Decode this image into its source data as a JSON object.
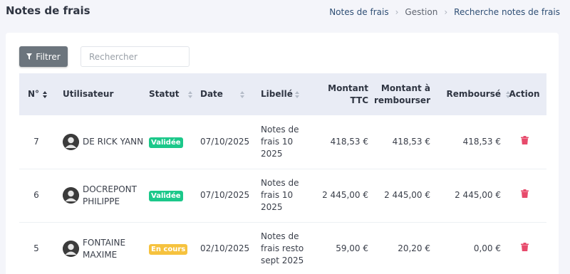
{
  "header": {
    "title": "Notes de frais",
    "breadcrumb": [
      {
        "label": "Notes de frais",
        "link": true
      },
      {
        "label": "Gestion",
        "link": false
      },
      {
        "label": "Recherche notes de frais",
        "link": true
      }
    ]
  },
  "toolbar": {
    "filter_label": "Filtrer",
    "search_placeholder": "Rechercher"
  },
  "table": {
    "columns": {
      "no": "N°",
      "user": "Utilisateur",
      "statut": "Statut",
      "date": "Date",
      "libelle": "Libellé",
      "ttc_line1": "Montant",
      "ttc_line2": "TTC",
      "remb_line1": "Montant à",
      "remb_line2": "rembourser",
      "rembourse": "Remboursé",
      "action": "Action"
    },
    "rows": [
      {
        "no": "7",
        "user_line1": "DE RICK YANN",
        "user_line2": "",
        "statut": "Validée",
        "date": "07/10/2025",
        "lib1": "Notes de",
        "lib2": "frais 10",
        "lib3": "2025",
        "ttc": "418,53 €",
        "remb": "418,53 €",
        "rembourse": "418,53 €"
      },
      {
        "no": "6",
        "user_line1": "DOCREPONT",
        "user_line2": "PHILIPPE",
        "statut": "Validée",
        "date": "07/10/2025",
        "lib1": "Notes de",
        "lib2": "frais 10",
        "lib3": "2025",
        "ttc": "2 445,00 €",
        "remb": "2 445,00 €",
        "rembourse": "2 445,00 €"
      },
      {
        "no": "5",
        "user_line1": "FONTAINE",
        "user_line2": "MAXIME",
        "statut": "En cours",
        "date": "02/10/2025",
        "lib1": "Notes de",
        "lib2": "frais resto",
        "lib3": "sept 2025",
        "ttc": "59,00 €",
        "remb": "20,20 €",
        "rembourse": "0,00 €"
      }
    ]
  },
  "icons": {
    "filter": "funnel-icon",
    "sort": "sort-icon",
    "avatar": "user-avatar-icon",
    "delete": "trash-icon"
  },
  "colors": {
    "validee": "#1cc88a",
    "en_cours": "#f6c23e",
    "delete": "#e74a6b",
    "filter_button": "#6c757d"
  }
}
